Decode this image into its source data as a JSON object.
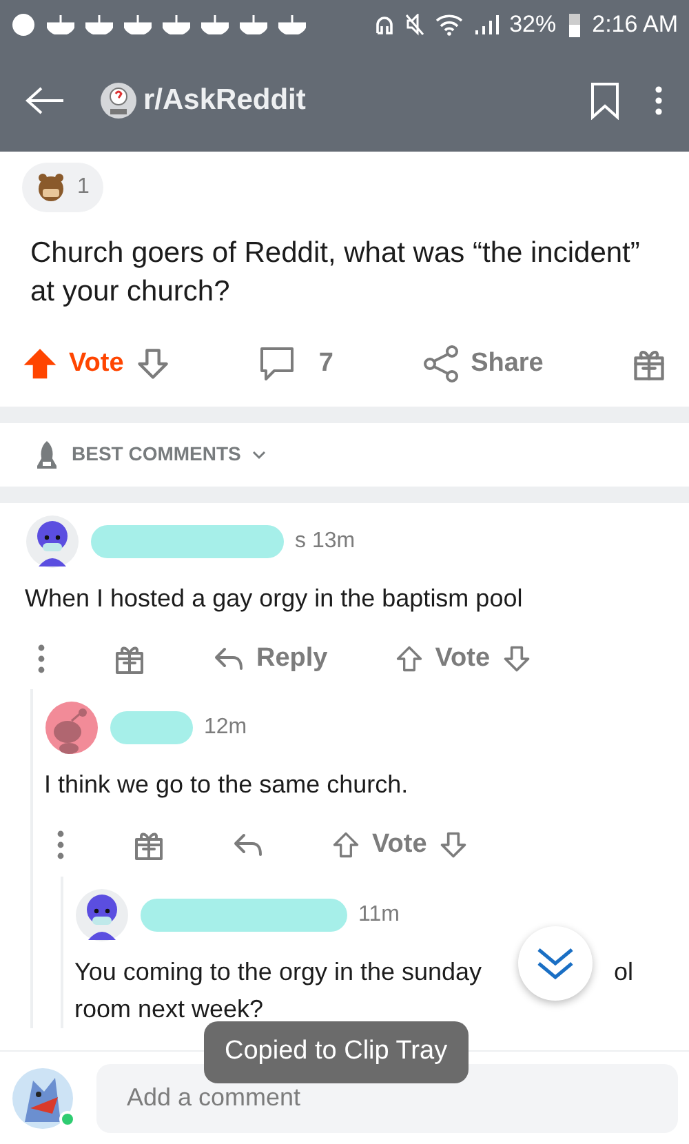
{
  "status_bar": {
    "battery": "32%",
    "time": "2:16 AM"
  },
  "app_bar": {
    "subreddit": "r/AskReddit"
  },
  "post": {
    "award_count": "1",
    "title": "Church goers of Reddit, what was “the incident” at your church?",
    "vote_label": "Vote",
    "upvoted": true,
    "comment_count": "7",
    "share_label": "Share"
  },
  "sort": {
    "label": "BEST COMMENTS"
  },
  "comments": [
    {
      "avatar": {
        "kind": "masked"
      },
      "meta": "s 13m",
      "lines": [
        "When I hosted a gay orgy in the baptism pool"
      ],
      "reply_label": "Reply",
      "vote_label": "Vote"
    },
    {
      "avatar": {
        "kind": "snoo"
      },
      "meta": "12m",
      "lines": [
        "I think we go to the same church."
      ],
      "vote_label": "Vote"
    },
    {
      "avatar": {
        "kind": "masked"
      },
      "meta": "11m",
      "lines": [
        "You coming to the orgy in the sunday",
        "ol",
        "room next week?"
      ]
    }
  ],
  "composer": {
    "placeholder": "Add a comment",
    "online": true
  },
  "toast": {
    "text": "Copied to Clip Tray"
  }
}
